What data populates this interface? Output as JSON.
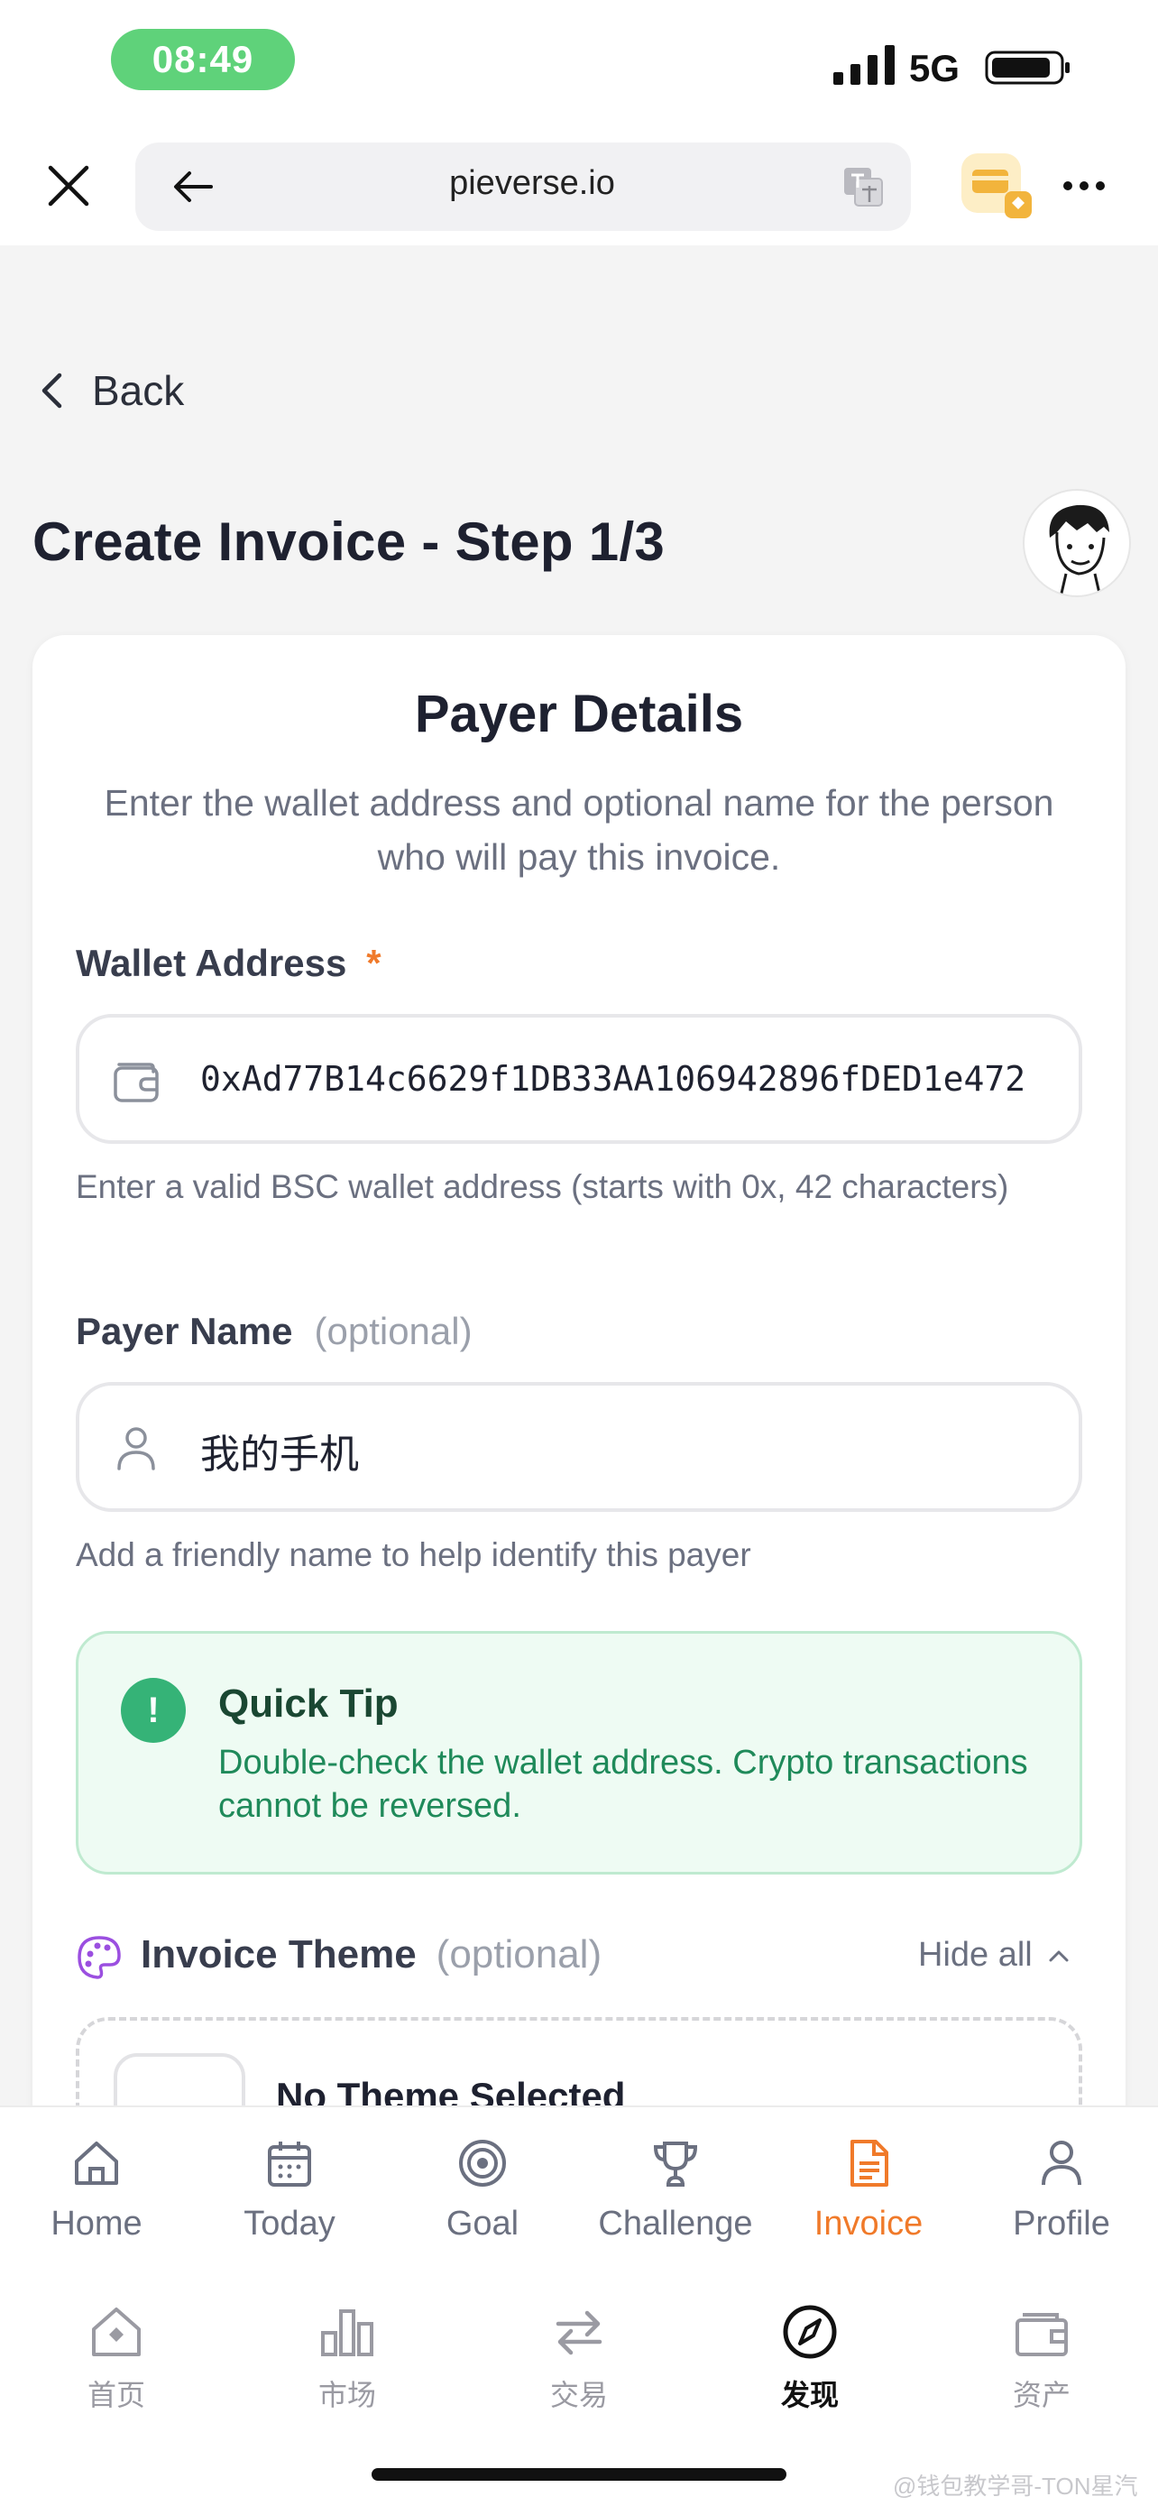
{
  "status": {
    "time": "08:49",
    "network": "5G"
  },
  "browser": {
    "url": "pieverse.io"
  },
  "page": {
    "back_label": "Back",
    "title": "Create Invoice - Step 1/3"
  },
  "payer_details": {
    "title": "Payer Details",
    "subtitle": "Enter the wallet address and optional name for the person who will pay this invoice.",
    "wallet": {
      "label": "Wallet Address",
      "required_mark": "*",
      "value": "0xAd77B14c6629f1DB33AA106942896fDED1e472",
      "hint": "Enter a valid BSC wallet address (starts with 0x, 42 characters)"
    },
    "payer": {
      "label": "Payer Name",
      "optional": "(optional)",
      "value": "我的手机",
      "hint": "Add a friendly name to help identify this payer"
    },
    "tip": {
      "icon_text": "!",
      "title": "Quick Tip",
      "body": "Double-check the wallet address. Crypto transactions cannot be reversed."
    },
    "theme": {
      "label": "Invoice Theme",
      "optional": "(optional)",
      "hide_all": "Hide all",
      "selected": "No Theme Selected"
    }
  },
  "app_tabs": [
    {
      "label": "Home",
      "icon": "home-icon"
    },
    {
      "label": "Today",
      "icon": "calendar-icon"
    },
    {
      "label": "Goal",
      "icon": "target-icon"
    },
    {
      "label": "Challenge",
      "icon": "trophy-icon"
    },
    {
      "label": "Invoice",
      "icon": "document-icon",
      "active": true
    },
    {
      "label": "Profile",
      "icon": "user-icon"
    }
  ],
  "wallet_nav": [
    {
      "label": "首页",
      "icon": "home-diamond-icon"
    },
    {
      "label": "市场",
      "icon": "bar-chart-icon"
    },
    {
      "label": "交易",
      "icon": "swap-icon"
    },
    {
      "label": "发现",
      "icon": "compass-icon",
      "active": true
    },
    {
      "label": "资产",
      "icon": "wallet-icon"
    }
  ],
  "watermark": "@钱包教学哥-TON星汽",
  "colors": {
    "accent": "#f07a2a",
    "tip_green": "#35b377",
    "tip_bg": "#eefbf3",
    "status_pill": "#5fd27a"
  }
}
